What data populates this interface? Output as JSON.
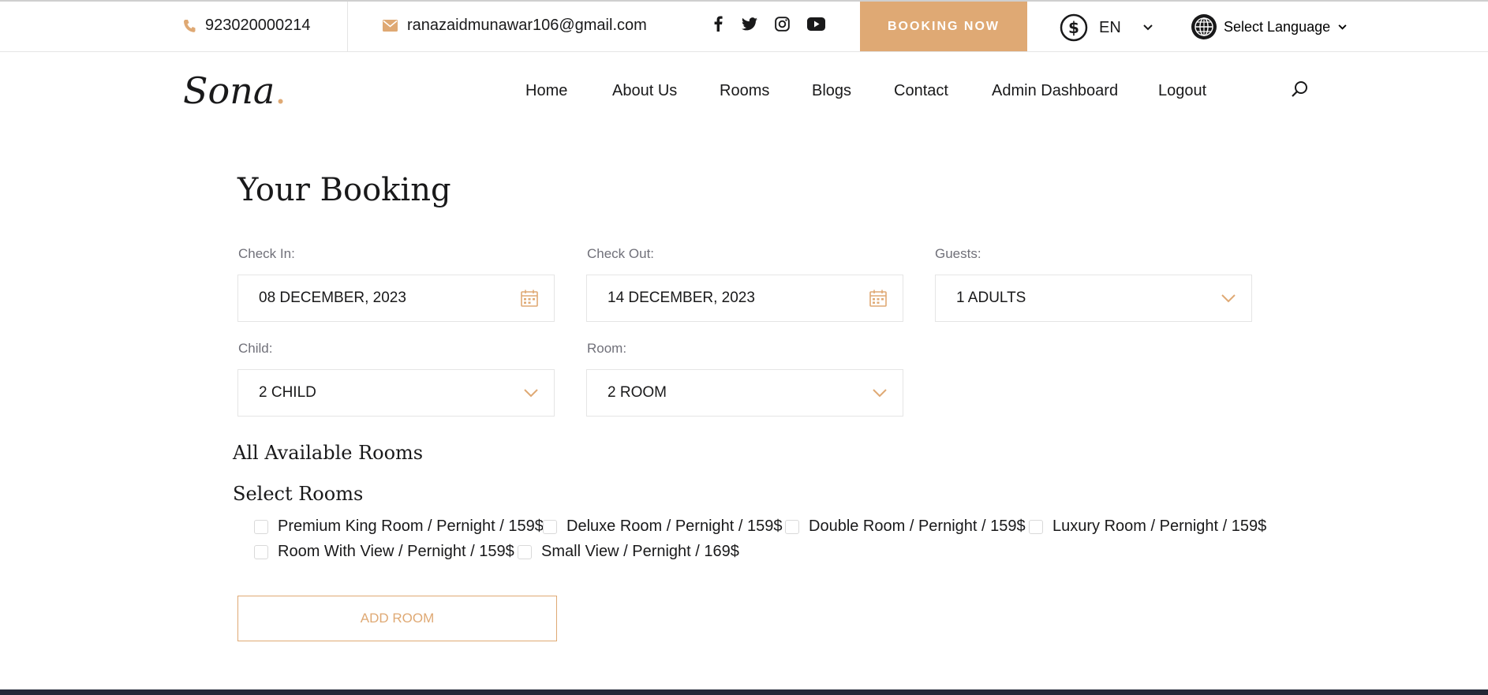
{
  "colors": {
    "accent": "#dfa974",
    "text": "#19191a",
    "muted": "#707079",
    "footer": "#222736"
  },
  "topbar": {
    "phone": "923020000214",
    "email": "ranazaidmunawar106@gmail.com",
    "social_icons": [
      "facebook-icon",
      "twitter-icon",
      "instagram-icon",
      "youtube-icon"
    ],
    "booking_label": "BOOKING NOW",
    "currency_language": "EN",
    "select_language": "Select Language"
  },
  "nav": {
    "logo_text": "Sona",
    "logo_dot": ".",
    "items": [
      "Home",
      "About Us",
      "Rooms",
      "Blogs",
      "Contact",
      "Admin Dashboard",
      "Logout"
    ]
  },
  "booking": {
    "title": "Your Booking",
    "check_in": {
      "label": "Check In:",
      "value": "08 December, 2023"
    },
    "check_out": {
      "label": "Check Out:",
      "value": "14 December, 2023"
    },
    "guests": {
      "label": "Guests:",
      "value": "1 Adults"
    },
    "child": {
      "label": "Child:",
      "value": "2 Child"
    },
    "room": {
      "label": "Room:",
      "value": "2 Room"
    },
    "all_available": "All Available Rooms",
    "select_rooms": "Select Rooms",
    "rooms": [
      "Premium King Room / Pernight / 159$",
      "Deluxe Room / Pernight / 159$",
      "Double Room / Pernight / 159$",
      "Luxury Room / Pernight / 159$",
      "Room With View / Pernight / 159$",
      "Small View / Pernight / 169$"
    ],
    "add_room": "Add Room"
  }
}
